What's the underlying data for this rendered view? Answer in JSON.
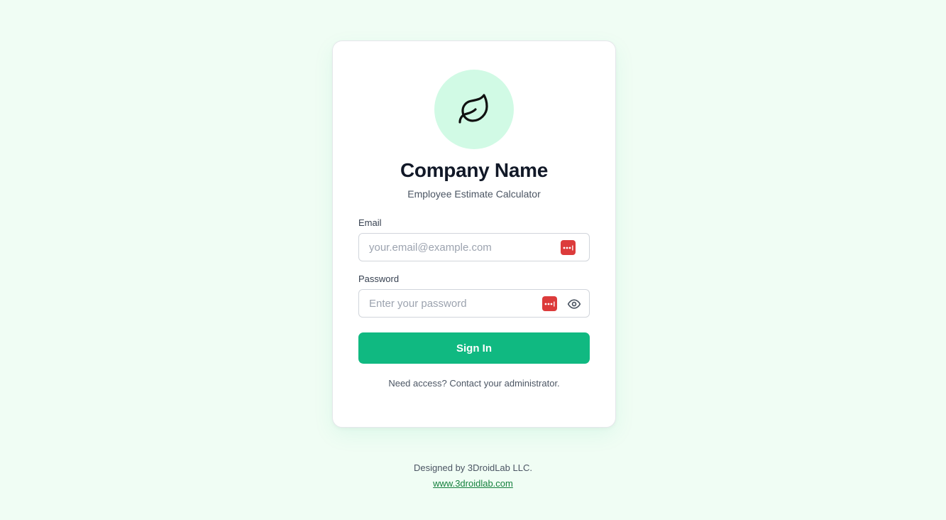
{
  "brand": {
    "logo_icon": "leaf-icon",
    "company_name": "Company Name",
    "tagline": "Employee Estimate Calculator",
    "accent_color": "#10b981",
    "logo_bg_color": "#d1fae5"
  },
  "form": {
    "email": {
      "label": "Email",
      "value": "",
      "placeholder": "your.email@example.com",
      "password_manager_icon": "password-manager-icon"
    },
    "password": {
      "label": "Password",
      "value": "",
      "placeholder": "Enter your password",
      "password_manager_icon": "password-manager-icon",
      "toggle_icon": "eye-icon"
    },
    "submit_label": "Sign In",
    "help_text": "Need access? Contact your administrator."
  },
  "footer": {
    "credit": "Designed by 3DroidLab LLC.",
    "link_text": "www.3droidlab.com"
  }
}
